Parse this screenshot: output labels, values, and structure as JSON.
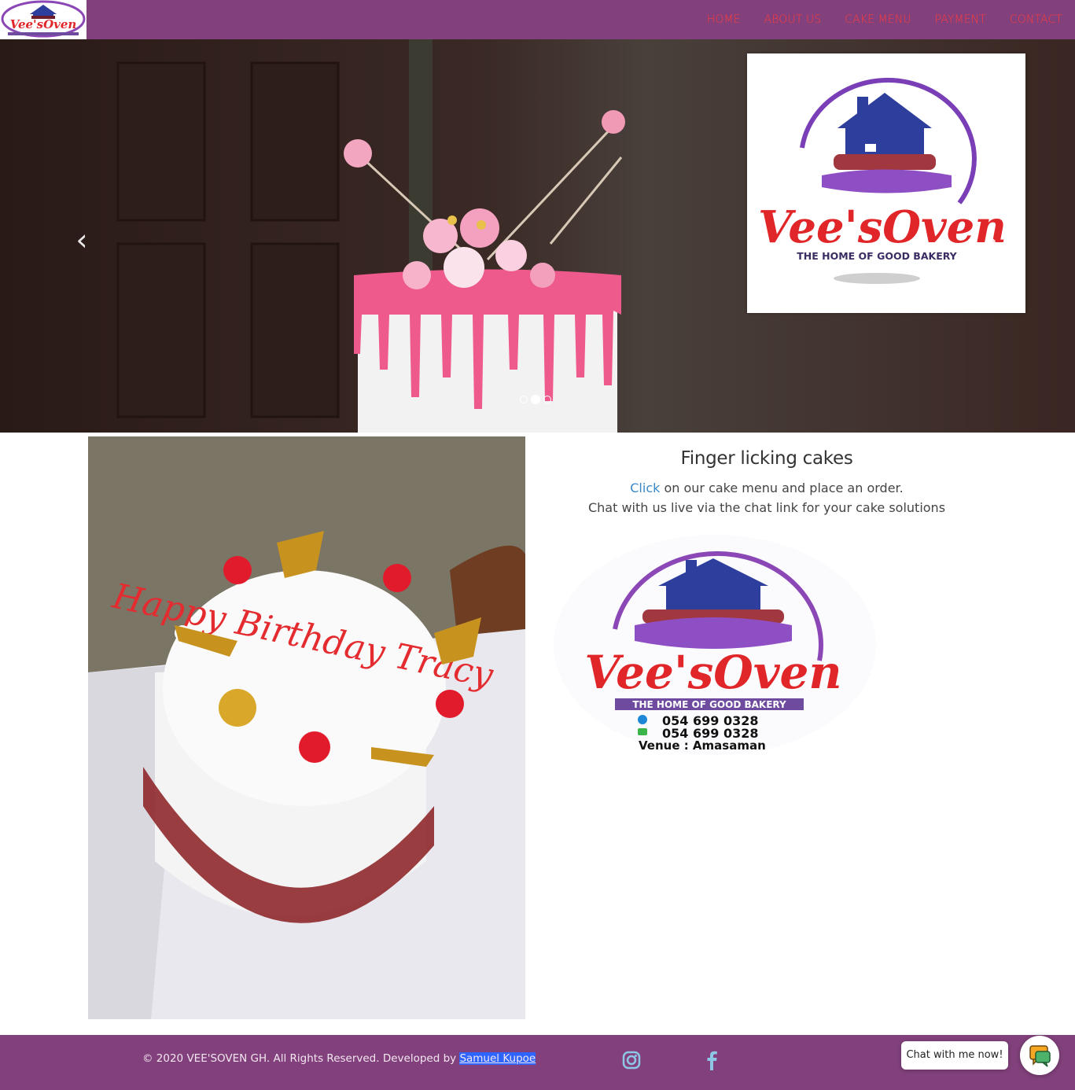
{
  "brand": {
    "logo_name": "Vee'sOven",
    "logo_tagline": "THE HOME OF GOOD BAKERY"
  },
  "nav": {
    "items": [
      {
        "label": "HOME"
      },
      {
        "label": "ABOUT US"
      },
      {
        "label": "CAKE MENU"
      },
      {
        "label": "PAYMENT"
      },
      {
        "label": "CONTACT"
      }
    ]
  },
  "carousel": {
    "prev_icon": "‹",
    "next_icon": "›",
    "slide_count": 3,
    "active_slide": 2,
    "logo_name": "Vee'sOven",
    "logo_tagline": "THE HOME OF GOOD BAKERY"
  },
  "content": {
    "cake_text": "Happy Birthday Tracy",
    "heading": "Finger licking cakes",
    "click_link": "Click",
    "line1_rest": " on our cake menu and place an order.",
    "line2": "Chat with us live via the chat link for your cake solutions",
    "promo": {
      "logo_name": "Vee'sOven",
      "tagline": "THE HOME OF GOOD BAKERY",
      "phone": "054 699 0328",
      "whatsapp": "054 699 0328",
      "venue": "Venue : Amasaman"
    }
  },
  "footer": {
    "copyright": "© 2020 VEE'SOVEN GH. All Rights Reserved. Developed by ",
    "developer_link": "Samuel Kupoe"
  },
  "chat": {
    "label": "Chat with me now!"
  },
  "colors": {
    "brand_purple": "#82417c",
    "nav_link": "#ff3a3a",
    "link_blue": "#3a87c7",
    "social_icon": "#8ec7e6"
  },
  "icons": [
    "chevron-left-icon",
    "chevron-right-icon",
    "instagram-icon",
    "facebook-icon",
    "chat-icon",
    "phone-icon",
    "whatsapp-icon"
  ]
}
